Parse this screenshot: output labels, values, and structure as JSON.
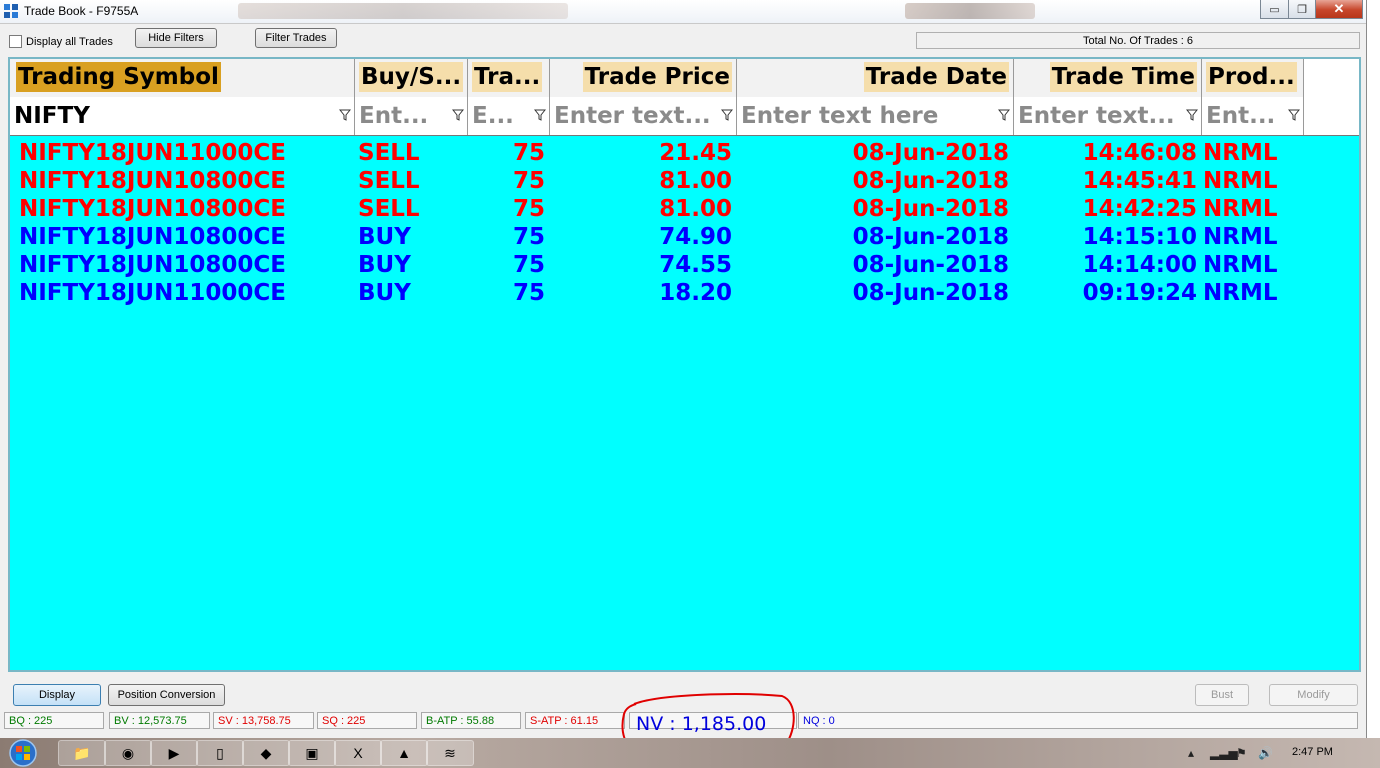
{
  "window": {
    "title": "Trade Book - F9755A",
    "controls": {
      "minimize": "▭",
      "restore": "❐",
      "close": "✕"
    }
  },
  "toolbar": {
    "display_all_label": "Display all Trades",
    "hide_filters_label": "Hide Filters",
    "filter_trades_label": "Filter Trades",
    "total_trades": "Total No. Of Trades : 6"
  },
  "grid": {
    "columns": [
      {
        "label": "Trading Symbol",
        "filter_value": "NIFTY",
        "filter_placeholder": ""
      },
      {
        "label": "Buy/S...",
        "filter_value": "",
        "filter_placeholder": "Ent..."
      },
      {
        "label": "Tra...",
        "filter_value": "",
        "filter_placeholder": "E..."
      },
      {
        "label": "Trade Price",
        "filter_value": "",
        "filter_placeholder": "Enter text..."
      },
      {
        "label": "Trade Date",
        "filter_value": "",
        "filter_placeholder": "Enter text here"
      },
      {
        "label": "Trade Time",
        "filter_value": "",
        "filter_placeholder": "Enter text..."
      },
      {
        "label": "Prod...",
        "filter_value": "",
        "filter_placeholder": "Ent..."
      }
    ],
    "rows": [
      {
        "symbol": "NIFTY18JUN11000CE",
        "side": "SELL",
        "qty": "75",
        "price": "21.45",
        "date": "08-Jun-2018",
        "time": "14:46:08",
        "product": "NRML"
      },
      {
        "symbol": "NIFTY18JUN10800CE",
        "side": "SELL",
        "qty": "75",
        "price": "81.00",
        "date": "08-Jun-2018",
        "time": "14:45:41",
        "product": "NRML"
      },
      {
        "symbol": "NIFTY18JUN10800CE",
        "side": "SELL",
        "qty": "75",
        "price": "81.00",
        "date": "08-Jun-2018",
        "time": "14:42:25",
        "product": "NRML"
      },
      {
        "symbol": "NIFTY18JUN10800CE",
        "side": "BUY",
        "qty": "75",
        "price": "74.90",
        "date": "08-Jun-2018",
        "time": "14:15:10",
        "product": "NRML"
      },
      {
        "symbol": "NIFTY18JUN10800CE",
        "side": "BUY",
        "qty": "75",
        "price": "74.55",
        "date": "08-Jun-2018",
        "time": "14:14:00",
        "product": "NRML"
      },
      {
        "symbol": "NIFTY18JUN11000CE",
        "side": "BUY",
        "qty": "75",
        "price": "18.20",
        "date": "08-Jun-2018",
        "time": "09:19:24",
        "product": "NRML"
      }
    ]
  },
  "actions": {
    "display_label": "Display",
    "position_conversion_label": "Position Conversion",
    "bust_label": "Bust",
    "modify_label": "Modify"
  },
  "summary": {
    "bq": "BQ : 225",
    "bv": "BV : 12,573.75",
    "sv": "SV : 13,758.75",
    "sq": "SQ : 225",
    "batp": "B-ATP : 55.88",
    "satp": "S-ATP : 61.15",
    "nv": "NV : 1,185.00",
    "nq": "NQ : 0"
  },
  "colors": {
    "grid_bg": "#00ffff",
    "sell": "#ff0000",
    "buy": "#0000ff",
    "header_selected": "#d9a021",
    "header": "#f5deab",
    "annotation": "#e00000"
  },
  "taskbar": {
    "clock": "2:47 PM",
    "items": [
      "explorer-icon",
      "chrome-icon",
      "media-player-icon",
      "document-icon",
      "trading-app-icon",
      "window-icon",
      "excel-icon",
      "paint-icon",
      "network-app-icon"
    ]
  }
}
